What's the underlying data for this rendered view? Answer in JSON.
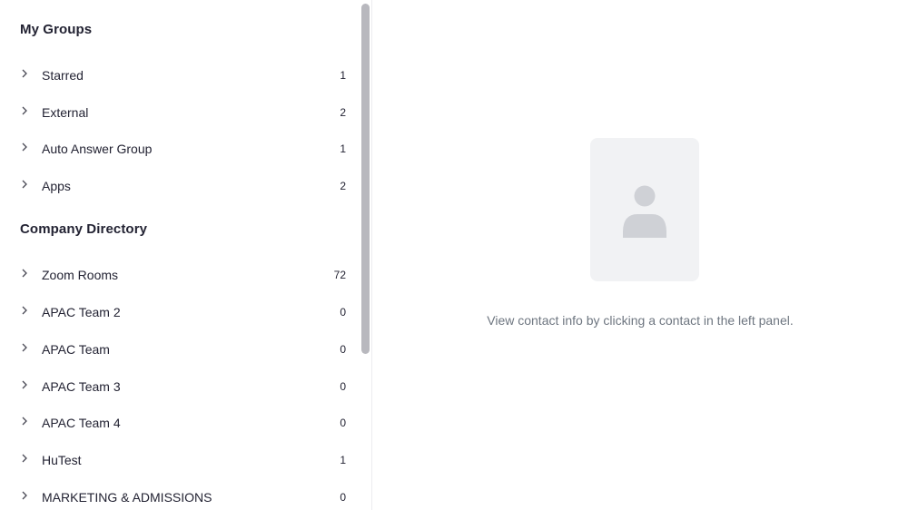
{
  "my_groups": {
    "title": "My Groups",
    "items": [
      {
        "label": "Starred",
        "count": "1"
      },
      {
        "label": "External",
        "count": "2"
      },
      {
        "label": "Auto Answer Group",
        "count": "1"
      },
      {
        "label": "Apps",
        "count": "2"
      }
    ]
  },
  "company_directory": {
    "title": "Company Directory",
    "items": [
      {
        "label": "Zoom Rooms",
        "count": "72"
      },
      {
        "label": "APAC Team 2",
        "count": "0"
      },
      {
        "label": "APAC Team",
        "count": "0"
      },
      {
        "label": "APAC Team 3",
        "count": "0"
      },
      {
        "label": "APAC Team 4",
        "count": "0"
      },
      {
        "label": "HuTest",
        "count": "1"
      },
      {
        "label": "MARKETING & ADMISSIONS",
        "count": "0"
      }
    ]
  },
  "detail_panel": {
    "empty_message": "View contact info by clicking a contact in the left panel.",
    "illustration_icon": "contact-book-icon",
    "tab_colors": [
      "#e8533f",
      "#f5c518",
      "#2cb84b",
      "#2d9fe8"
    ]
  },
  "colors": {
    "text_primary": "#232333",
    "text_secondary": "#6e7680",
    "scrollbar": "#b8b8be"
  }
}
